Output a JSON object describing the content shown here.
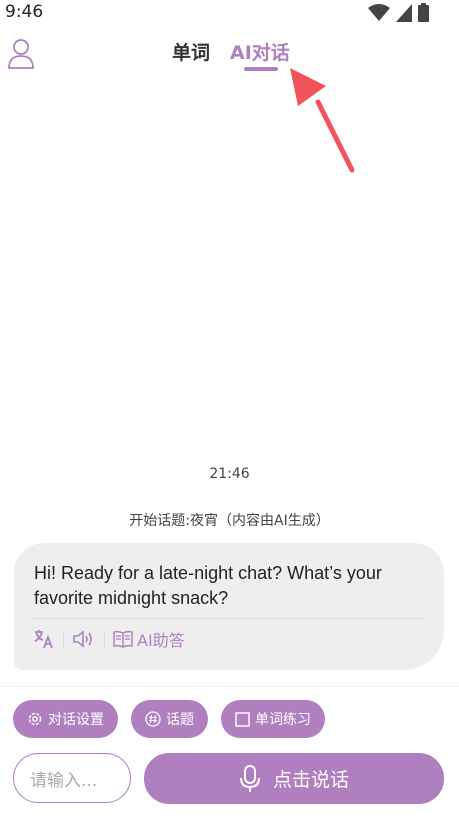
{
  "status_bar": {
    "time": "9:46"
  },
  "header": {
    "tabs": [
      {
        "label": "单词",
        "active": false
      },
      {
        "label": "AI对话",
        "active": true
      }
    ]
  },
  "chat": {
    "timestamp": "21:46",
    "topic_line": "开始话题:夜宵（内容由AI生成）",
    "messages": [
      {
        "text": "Hi! Ready for a late-night chat? What’s your favorite midnight snack?",
        "tools": {
          "assist_label": "AI助答"
        }
      }
    ]
  },
  "bottom_bar": {
    "chips": [
      {
        "label": "对话设置",
        "icon": "gear-icon"
      },
      {
        "label": "话题",
        "icon": "hashtag-icon"
      },
      {
        "label": "单词练习",
        "icon": "checkbox-icon"
      }
    ],
    "input_placeholder": "请输入...",
    "talk_button_label": "点击说话"
  },
  "colors": {
    "accent": "#b07fc0",
    "bubble_bg": "#eeeeee",
    "arrow": "#f2525a"
  }
}
